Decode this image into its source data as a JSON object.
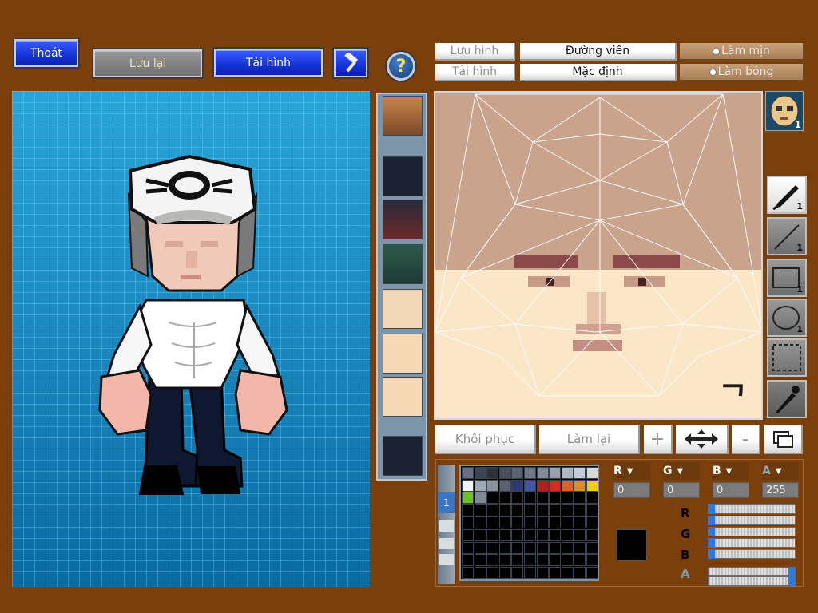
{
  "toolbar": {
    "exit_label": "Thoát",
    "save_label": "Lưu lại",
    "load_label": "Tải hình",
    "help_symbol": "?"
  },
  "texture_toolbar": {
    "save_image_label": "Lưu hình",
    "load_image_label": "Tải hình",
    "outline_label": "Đường viền",
    "default_label": "Mặc định",
    "smooth_label": "Làm mịn",
    "shade_label": "Làm bóng"
  },
  "edit_buttons": {
    "restore_label": "Khôi phục",
    "redo_label": "Làm lại",
    "plus_label": "+",
    "minus_label": "-"
  },
  "tools": [
    {
      "name": "pen",
      "count": "1"
    },
    {
      "name": "line",
      "count": "1"
    },
    {
      "name": "rectangle",
      "count": "1"
    },
    {
      "name": "ellipse",
      "count": "1"
    },
    {
      "name": "selection",
      "count": ""
    },
    {
      "name": "eyedropper",
      "count": ""
    }
  ],
  "face_preview_count": "1",
  "color": {
    "r_label": "R",
    "g_label": "G",
    "b_label": "B",
    "a_label": "A",
    "r": "0",
    "g": "0",
    "b": "0",
    "a": "255",
    "current_hex": "#000000"
  },
  "palette_tab": "1",
  "palette": [
    "#6a7080",
    "#3e4450",
    "#2c3038",
    "#4a505a",
    "#5c6270",
    "#707684",
    "#858b98",
    "#9aa0ac",
    "#b0b6c0",
    "#c6ccd4",
    "#d8d8d8",
    "#f2f2f2",
    "#a0a8b8",
    "#8a92a0",
    "#5a6070",
    "#2a3c70",
    "#3c58a0",
    "#c01818",
    "#d82828",
    "#e06020",
    "#d89020",
    "#f0d000",
    "#70c020",
    "#808898"
  ],
  "colors": {
    "background": "#7a3f0a",
    "accent_blue": "#1633d8",
    "canvas_blue": "#1a8bc4"
  },
  "corner_glyph": "ᄀ"
}
